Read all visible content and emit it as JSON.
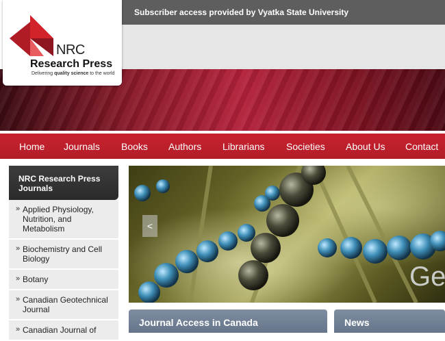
{
  "header": {
    "subscriber_text": "Subscriber access provided by Vyatka State University"
  },
  "logo": {
    "name_line1": "NRC",
    "name_line2": "Research Press",
    "tagline_pre": "Delivering ",
    "tagline_bold": "quality science",
    "tagline_post": " to the world"
  },
  "nav": {
    "items": [
      "Home",
      "Journals",
      "Books",
      "Authors",
      "Librarians",
      "Societies",
      "About Us",
      "Contact"
    ]
  },
  "sidebar": {
    "title": "NRC Research Press Journals",
    "items": [
      "Applied Physiology, Nutrition, and Metabolism",
      "Biochemistry and Cell Biology",
      "Botany",
      "Canadian Geotechnical Journal",
      "Canadian Journal of"
    ]
  },
  "hero": {
    "overlay_text": "Ge",
    "prev_symbol": "<"
  },
  "panels": {
    "journal_access": "Journal Access in Canada",
    "news": "News"
  },
  "colors": {
    "nav_red": "#c8222f",
    "sidebar_head": "#333333",
    "panel_blue": "#75839a",
    "logo_red": "#d2232a"
  }
}
